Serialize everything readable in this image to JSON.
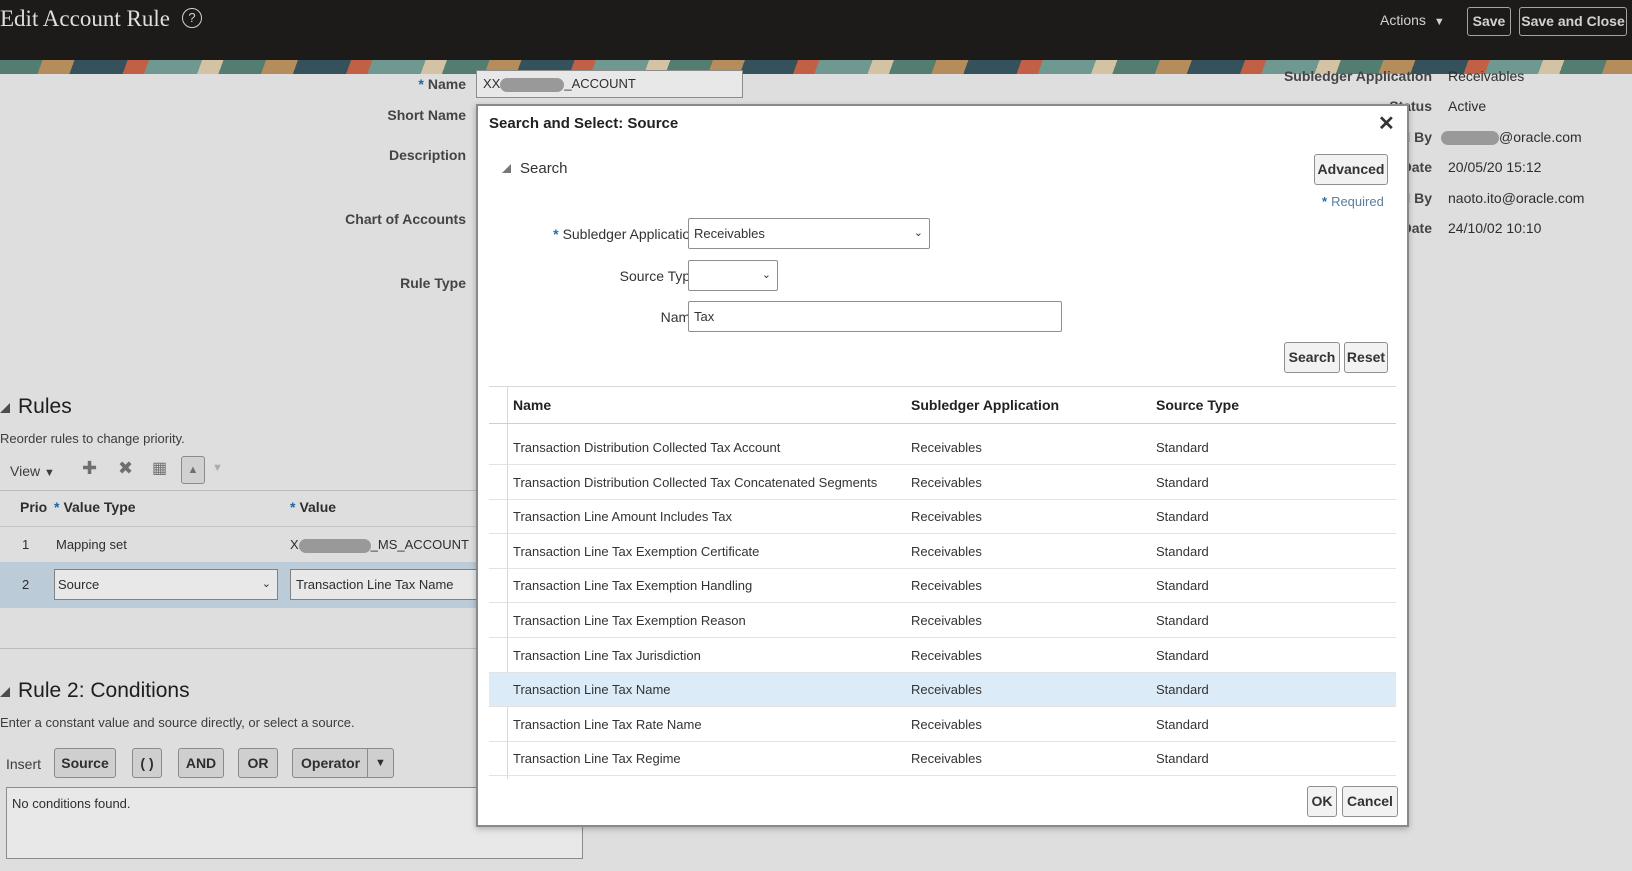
{
  "page": {
    "title": "Edit Account Rule",
    "actions_label": "Actions",
    "save_label": "Save",
    "save_close_label": "Save and Close"
  },
  "form": {
    "name_label": "Name",
    "name_prefix": "XX",
    "name_suffix": "_ACCOUNT",
    "short_name_label": "Short Name",
    "description_label": "Description",
    "coa_label": "Chart of Accounts",
    "rule_type_label": "Rule Type",
    "subledger_app_label": "Subledger Application",
    "subledger_app_value": "Receivables",
    "status_label": "Status",
    "status_value": "Active",
    "created_by_label": "d By",
    "created_by_value": "@oracle.com",
    "creation_date_label": "Date",
    "creation_date_value": "20/05/20 15:12",
    "updated_by_label": "d By",
    "updated_by_value": "naoto.ito@oracle.com",
    "update_date_label": "Date",
    "update_date_value": "24/10/02 10:10"
  },
  "rules": {
    "title": "Rules",
    "help": "Reorder rules to change priority.",
    "view_label": "View",
    "col_priority": "Prio",
    "col_value_type": "Value Type",
    "col_value": "Value",
    "rows": [
      {
        "priority": "1",
        "value_type": "Mapping set",
        "value_prefix": "X",
        "value_suffix": "_MS_ACCOUNT"
      },
      {
        "priority": "2",
        "value_type": "Source",
        "value": "Transaction Line Tax Name"
      }
    ]
  },
  "conditions": {
    "title": "Rule 2: Conditions",
    "help": "Enter a constant value and source directly, or select a source.",
    "insert_label": "Insert",
    "buttons": [
      "Source",
      "( )",
      "AND",
      "OR",
      "Operator"
    ],
    "empty_text": "No conditions found."
  },
  "dialog": {
    "title": "Search and Select: Source",
    "search_label": "Search",
    "advanced_label": "Advanced",
    "required_label": "Required",
    "subledger_label": "Subledger Application",
    "subledger_value": "Receivables",
    "source_type_label": "Source Type",
    "source_type_value": "",
    "name_label": "Name",
    "name_value": "Tax",
    "search_button": "Search",
    "reset_button": "Reset",
    "columns": [
      "Name",
      "Subledger Application",
      "Source Type"
    ],
    "results": [
      {
        "name": "Transaction Distribution Collected Tax Account",
        "app": "Receivables",
        "type": "Standard"
      },
      {
        "name": "Transaction Distribution Collected Tax Concatenated Segments",
        "app": "Receivables",
        "type": "Standard"
      },
      {
        "name": "Transaction Line Amount Includes Tax",
        "app": "Receivables",
        "type": "Standard"
      },
      {
        "name": "Transaction Line Tax Exemption Certificate",
        "app": "Receivables",
        "type": "Standard"
      },
      {
        "name": "Transaction Line Tax Exemption Handling",
        "app": "Receivables",
        "type": "Standard"
      },
      {
        "name": "Transaction Line Tax Exemption Reason",
        "app": "Receivables",
        "type": "Standard"
      },
      {
        "name": "Transaction Line Tax Jurisdiction",
        "app": "Receivables",
        "type": "Standard"
      },
      {
        "name": "Transaction Line Tax Name",
        "app": "Receivables",
        "type": "Standard"
      },
      {
        "name": "Transaction Line Tax Rate Name",
        "app": "Receivables",
        "type": "Standard"
      },
      {
        "name": "Transaction Line Tax Regime",
        "app": "Receivables",
        "type": "Standard"
      }
    ],
    "ok_label": "OK",
    "cancel_label": "Cancel"
  }
}
